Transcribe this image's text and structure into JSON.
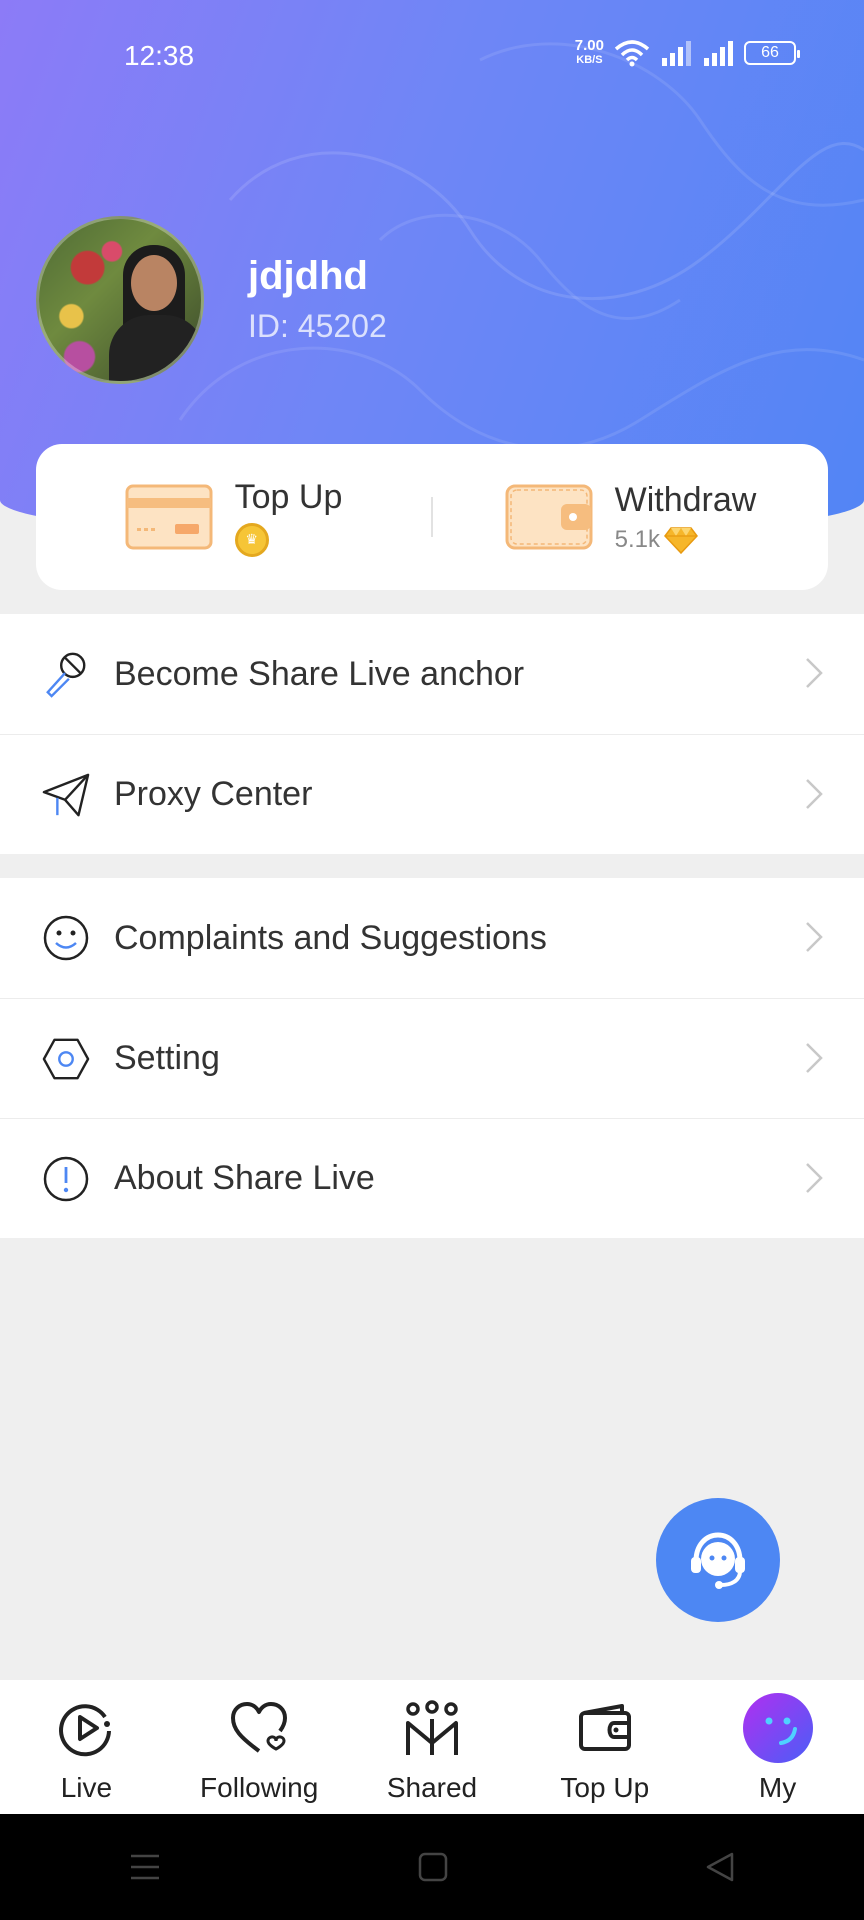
{
  "status_bar": {
    "time": "12:38",
    "net_speed_value": "7.00",
    "net_speed_unit": "KB/S",
    "battery": "66"
  },
  "profile": {
    "username": "jdjdhd",
    "user_id": "ID: 45202"
  },
  "wallet": {
    "top_up_label": "Top Up",
    "withdraw_label": "Withdraw",
    "withdraw_amount": "5.1k"
  },
  "menu_group_1": [
    {
      "label": "Become Share Live anchor",
      "icon": "microphone-icon"
    },
    {
      "label": "Proxy Center",
      "icon": "paper-plane-icon"
    }
  ],
  "menu_group_2": [
    {
      "label": "Complaints and Suggestions",
      "icon": "smiley-icon"
    },
    {
      "label": "Setting",
      "icon": "hexagon-settings-icon"
    },
    {
      "label": "About Share Live",
      "icon": "info-icon"
    }
  ],
  "tabbar": [
    {
      "label": "Live",
      "icon": "play-circle-icon"
    },
    {
      "label": "Following",
      "icon": "heart-icon"
    },
    {
      "label": "Shared",
      "icon": "people-icon"
    },
    {
      "label": "Top Up",
      "icon": "wallet-icon"
    },
    {
      "label": "My",
      "icon": "my-avatar-icon"
    }
  ],
  "colors": {
    "header_gradient_start": "#8c7bf7",
    "header_gradient_end": "#5285f5",
    "accent_blue": "#4d87f3",
    "card_orange": "#f7c896"
  }
}
